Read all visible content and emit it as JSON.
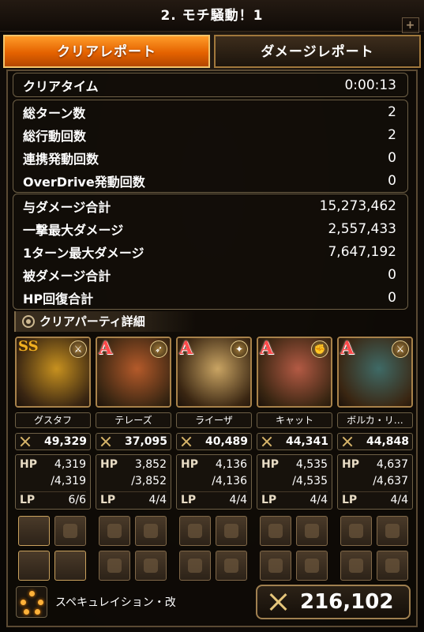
{
  "title": "2. モチ騒動！1",
  "tabs": {
    "clear_report": "クリアレポート",
    "damage_report": "ダメージレポート"
  },
  "clear_time": {
    "label": "クリアタイム",
    "value": "0:00:13"
  },
  "turn_stats": [
    {
      "label": "総ターン数",
      "value": "2"
    },
    {
      "label": "総行動回数",
      "value": "2"
    },
    {
      "label": "連携発動回数",
      "value": "0"
    },
    {
      "label": "OverDrive発動回数",
      "value": "0"
    }
  ],
  "damage_stats": [
    {
      "label": "与ダメージ合計",
      "value": "15,273,462"
    },
    {
      "label": "一撃最大ダメージ",
      "value": "2,557,433"
    },
    {
      "label": "1ターン最大ダメージ",
      "value": "7,647,192"
    },
    {
      "label": "被ダメージ合計",
      "value": "0"
    },
    {
      "label": "HP回復合計",
      "value": "0"
    }
  ],
  "party_heading": "クリアパーティ詳細",
  "party": [
    {
      "rank": "SS",
      "name": "グスタフ",
      "weapon_icon": "sword-icon",
      "power": "49,329",
      "hp_label": "HP",
      "hp": "4,319",
      "hp_max": "/4,319",
      "lp_label": "LP",
      "lp": "6/6",
      "art": "#c7911f"
    },
    {
      "rank": "A",
      "name": "テレーズ",
      "weapon_icon": "bow-icon",
      "power": "37,095",
      "hp_label": "HP",
      "hp": "3,852",
      "hp_max": "/3,852",
      "lp_label": "LP",
      "lp": "4/4",
      "art": "#b45a2a"
    },
    {
      "rank": "A",
      "name": "ライーザ",
      "weapon_icon": "staff-icon",
      "power": "40,489",
      "hp_label": "HP",
      "hp": "4,136",
      "hp_max": "/4,136",
      "lp_label": "LP",
      "lp": "4/4",
      "art": "#c9a463"
    },
    {
      "rank": "A",
      "name": "キャット",
      "weapon_icon": "fist-icon",
      "power": "44,341",
      "hp_label": "HP",
      "hp": "4,535",
      "hp_max": "/4,535",
      "lp_label": "LP",
      "lp": "4/4",
      "art": "#b35a44"
    },
    {
      "rank": "A",
      "name": "ボルカ・リ…",
      "weapon_icon": "sword-icon",
      "power": "44,848",
      "hp_label": "HP",
      "hp": "4,637",
      "hp_max": "/4,637",
      "lp_label": "LP",
      "lp": "4/4",
      "art": "#3f6a66"
    }
  ],
  "formation": {
    "name": "スペキュレイション・改"
  },
  "total_power": "216,102",
  "colors": {
    "accent_orange": "#e46200",
    "gold_border": "#a8824a",
    "rank_a": "#ff4a4a",
    "rank_ss": "#f2b020"
  }
}
